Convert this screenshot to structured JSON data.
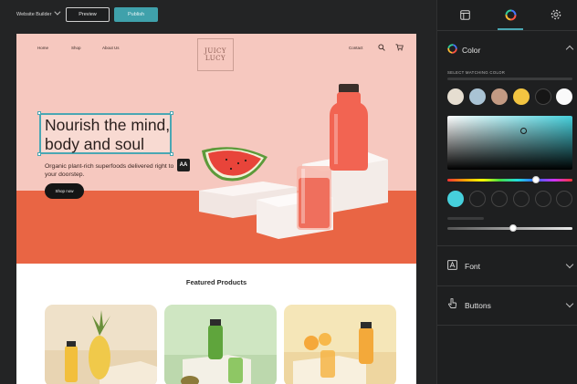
{
  "topbar": {
    "app_title": "Website Builder",
    "preview_label": "Preview",
    "publish_label": "Publish"
  },
  "site": {
    "nav": {
      "home": "Home",
      "shop": "Shop",
      "about": "About Us",
      "contact": "Contact"
    },
    "logo_line1": "JUICY",
    "logo_line2": "LUCY",
    "headline": "Nourish the mind, body and soul",
    "subtext": "Organic plant-rich superfoods delivered right to your doorstep.",
    "shop_button": "Shop now",
    "aa_label": "AA",
    "featured_title": "Featured Products"
  },
  "sidebar": {
    "tabs": [
      {
        "icon": "layout-icon"
      },
      {
        "icon": "color-wheel-icon",
        "active": true
      },
      {
        "icon": "settings-icon"
      }
    ],
    "color": {
      "title": "Color",
      "select_label": "SELECT MATCHING COLOR",
      "swatches": [
        "#e6ded1",
        "#a9c3d4",
        "#c39a83",
        "#f2c441",
        "#161616",
        "#fafafa"
      ],
      "selected_color": "#46d0dc",
      "hue_value": 0.71,
      "opacity_value": 0.55
    },
    "font": {
      "title": "Font"
    },
    "buttons": {
      "title": "Buttons"
    }
  },
  "colors": {
    "accent": "#4aa7b3",
    "hero_bg": "#f6c8bf",
    "hero_floor": "#e96544"
  }
}
